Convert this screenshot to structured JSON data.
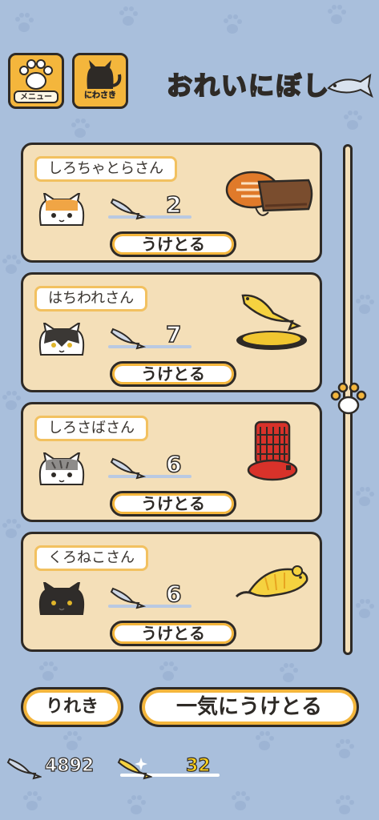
{
  "header": {
    "menu_label": "メニュー",
    "yard_label": "にわさき",
    "title": "おれいにぼし"
  },
  "gifts": [
    {
      "cat_name": "しろちゃとらさん",
      "fish_count": "2",
      "receive_label": "うけとる",
      "item_icon": "fish-pillow-and-mat-icon"
    },
    {
      "cat_name": "はちわれさん",
      "fish_count": "7",
      "receive_label": "うけとる",
      "item_icon": "golden-fish-trophy-icon"
    },
    {
      "cat_name": "しろさばさん",
      "fish_count": "6",
      "receive_label": "うけとる",
      "item_icon": "red-heater-icon"
    },
    {
      "cat_name": "くろねこさん",
      "fish_count": "6",
      "receive_label": "うけとる",
      "item_icon": "yellow-mouse-toy-icon"
    }
  ],
  "footer": {
    "history_label": "りれき",
    "receive_all_label": "一気にうけとる",
    "silver_fish_count": "4892",
    "gold_fish_count": "32"
  },
  "colors": {
    "background": "#a9bfdc",
    "card": "#f4dfb8",
    "accent": "#f4b63c",
    "gold_text": "#ffd21c"
  }
}
